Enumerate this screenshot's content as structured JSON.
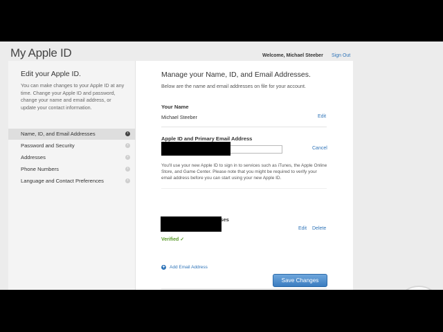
{
  "header": {
    "site_title": "My Apple ID",
    "welcome": "Welcome, Michael Steeber",
    "sign_out": "Sign Out"
  },
  "sidebar": {
    "title": "Edit your Apple ID.",
    "description": "You can make changes to your Apple ID at any time. Change your Apple ID and password, change your name and email address, or update your contact information.",
    "items": [
      {
        "label": "Name, ID, and Email Addresses",
        "active": true
      },
      {
        "label": "Password and Security"
      },
      {
        "label": "Addresses"
      },
      {
        "label": "Phone Numbers"
      },
      {
        "label": "Language and Contact Preferences"
      }
    ]
  },
  "main": {
    "title": "Manage your Name, ID, and Email Addresses.",
    "subtitle": "Below are the name and email addresses on file for your account.",
    "name_section": {
      "label": "Your Name",
      "value": "Michael Steeber",
      "edit": "Edit"
    },
    "appleid_section": {
      "label": "Apple ID and Primary Email Address",
      "input_value": "",
      "cancel": "Cancel",
      "note": "You'll use your new Apple ID to sign in to services such as iTunes, the Apple Online Store, and Game Center. Please note that you might be required to verify your email address before you can start using your new Apple ID."
    },
    "addresses_section": {
      "label_visible": "sses",
      "edit": "Edit",
      "delete": "Delete",
      "verified": "Verified ✓"
    },
    "add_email": "Add Email Address",
    "save_button": "Save Changes"
  },
  "colors": {
    "link": "#2f74b8",
    "verified": "#5a9a2a",
    "button": "#3a7cc0"
  }
}
